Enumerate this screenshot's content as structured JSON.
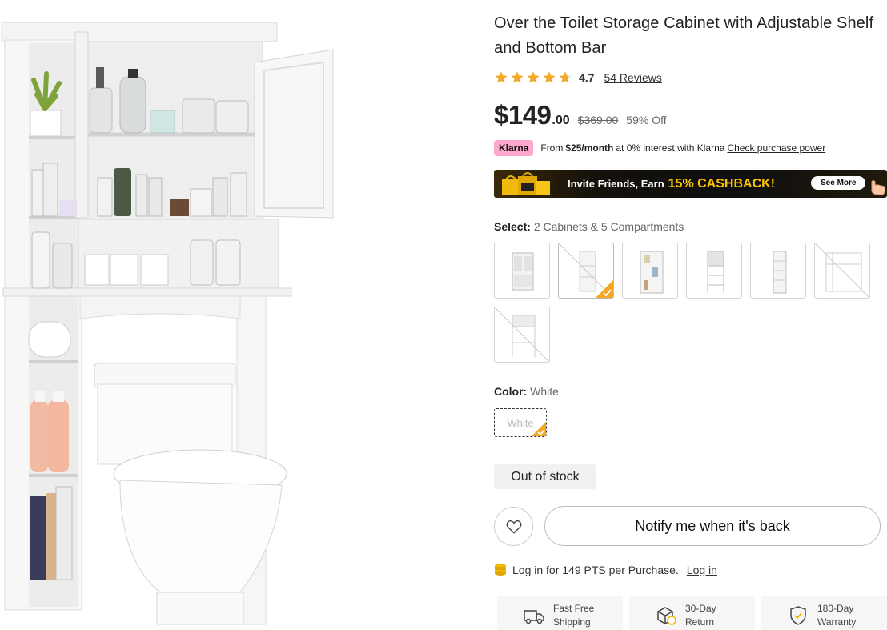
{
  "product": {
    "title": "Over the Toilet Storage Cabinet with Adjustable Shelf and Bottom Bar",
    "rating": {
      "stars": 4.7,
      "value": "4.7",
      "reviews_label": "54 Reviews"
    },
    "price": {
      "current_main": "$149",
      "current_cents": ".00",
      "original": "$369.00",
      "discount": "59% Off"
    }
  },
  "klarna": {
    "badge": "Klarna",
    "prefix": "From",
    "amount": "$25/month",
    "middle": "at 0% interest with Klarna",
    "link": "Check purchase power"
  },
  "cashback_banner": {
    "text": "Invite Friends, Earn",
    "highlight": "15% CASHBACK!",
    "button": "See More"
  },
  "select": {
    "label": "Select:",
    "value": "2 Cabinets & 5 Compartments",
    "options": [
      {
        "icon": "two-door-cabinet-thumb",
        "state": "available"
      },
      {
        "icon": "over-toilet-rack-thumb",
        "state": "selected-unavailable"
      },
      {
        "icon": "cabinet-with-shelves-thumb",
        "state": "available"
      },
      {
        "icon": "ladder-shelf-thumb",
        "state": "available"
      },
      {
        "icon": "drawer-tower-thumb",
        "state": "available"
      },
      {
        "icon": "open-rack-thumb",
        "state": "unavailable"
      },
      {
        "icon": "tall-rack-thumb",
        "state": "unavailable"
      }
    ]
  },
  "color": {
    "label": "Color:",
    "value": "White",
    "option_label": "White"
  },
  "stock": {
    "status": "Out of stock"
  },
  "actions": {
    "notify_label": "Notify me when it's back"
  },
  "points": {
    "text": "Log in for 149 PTS per Purchase.",
    "link": "Log in"
  },
  "services": [
    {
      "icon": "truck-icon",
      "line1": "Fast Free",
      "line2": "Shipping"
    },
    {
      "icon": "return-box-icon",
      "line1": "30-Day",
      "line2": "Return"
    },
    {
      "icon": "shield-check-icon",
      "line1": "180-Day",
      "line2": "Warranty"
    }
  ],
  "colors": {
    "star": "#f5a623",
    "klarna_pink": "#ffa8cd",
    "cashback_gold": "#ffc400",
    "coin": "#f2b705"
  }
}
